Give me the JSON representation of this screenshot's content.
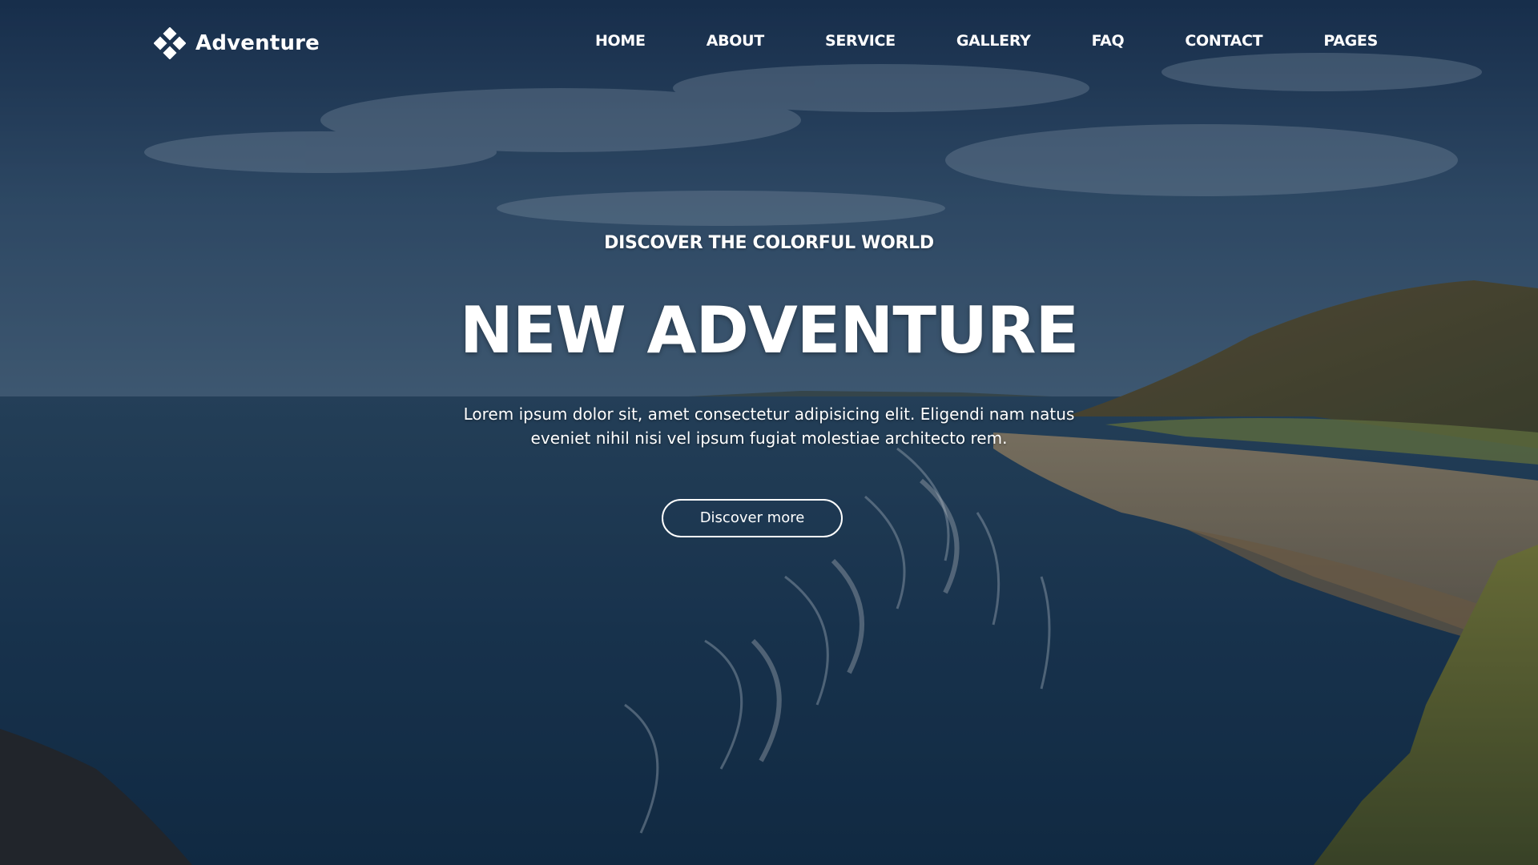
{
  "brand": {
    "name": "Adventure",
    "icon": "diamond-cluster-icon"
  },
  "nav": {
    "items": [
      {
        "label": "HOME"
      },
      {
        "label": "ABOUT"
      },
      {
        "label": "SERVICE"
      },
      {
        "label": "GALLERY"
      },
      {
        "label": "FAQ"
      },
      {
        "label": "CONTACT"
      },
      {
        "label": "PAGES"
      }
    ]
  },
  "hero": {
    "eyebrow": "DISCOVER THE COLORFUL WORLD",
    "title": "NEW ADVENTURE",
    "description": "Lorem ipsum dolor sit, amet consectetur adipisicing elit. Eligendi nam natus eveniet nihil nisi vel ipsum fugiat molestiae architecto rem.",
    "cta_label": "Discover more"
  },
  "colors": {
    "text": "#ffffff",
    "sky": "#2a4a68",
    "sea": "#1b3a55",
    "sand": "#b59a6a",
    "hill": "#5e5a2c"
  }
}
